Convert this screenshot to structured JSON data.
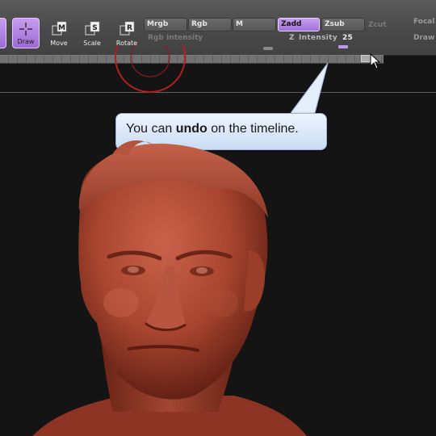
{
  "toolbar": {
    "tools": [
      {
        "label": "Draw",
        "active": true,
        "icon": "draw-icon"
      },
      {
        "label": "Move",
        "active": false,
        "icon": "move-icon"
      },
      {
        "label": "Scale",
        "active": false,
        "icon": "scale-icon"
      },
      {
        "label": "Rotate",
        "active": false,
        "icon": "rotate-icon"
      }
    ],
    "color_modes": [
      {
        "label": "Mrgb",
        "active": false
      },
      {
        "label": "Rgb",
        "active": false
      },
      {
        "label": "M",
        "active": false
      }
    ],
    "z_modes": [
      {
        "label": "Zadd",
        "active": true
      },
      {
        "label": "Zsub",
        "active": false
      },
      {
        "label": "Zcut",
        "active": false,
        "disabled": true
      }
    ],
    "rgb_intensity_label": "Rgb Intensity",
    "z_intensity": {
      "label": "Intensity",
      "value": "25"
    },
    "right_labels": [
      "Focal",
      "Draw"
    ]
  },
  "tooltip": {
    "prefix": "You can ",
    "bold": "undo",
    "suffix": " on the timeline."
  },
  "colors": {
    "accent": "#b388eb",
    "sculpt_material": "#a8452f",
    "tooltip_bg": "#dde9f9"
  }
}
